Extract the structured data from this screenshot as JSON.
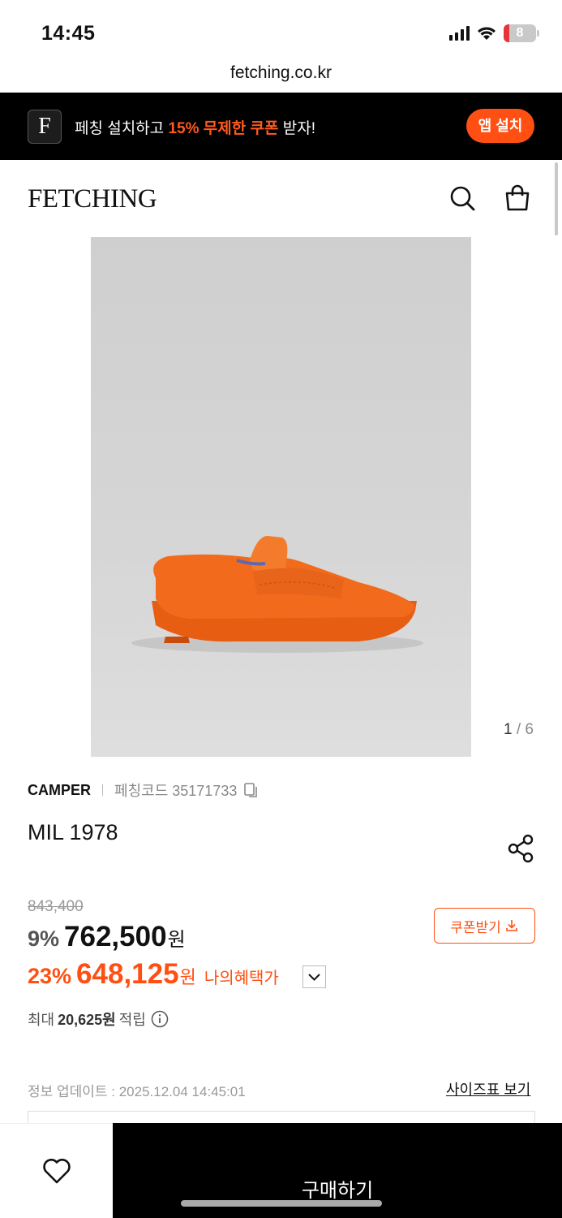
{
  "status": {
    "time": "14:45",
    "battery": "8"
  },
  "browser": {
    "url": "fetching.co.kr"
  },
  "banner": {
    "logo_letter": "F",
    "text_pre": "페칭 설치하고 ",
    "text_highlight": "15% 무제한 쿠폰",
    "text_post": " 받자!",
    "install_label": "앱 설치"
  },
  "header": {
    "logo": "FETCHING"
  },
  "gallery": {
    "current": "1",
    "divider": " / ",
    "total": "6"
  },
  "product": {
    "brand": "CAMPER",
    "code_label": "페칭코드 35171733",
    "name": "MIL 1978"
  },
  "pricing": {
    "original": "843,400",
    "discount1": "9%",
    "price1": "762,500",
    "won": "원",
    "coupon_label": "쿠폰받기",
    "discount2": "23%",
    "price2": "648,125",
    "benefit_label": "나의혜택가",
    "points_pre": "최대",
    "points_value": "20,625원",
    "points_post": "적립"
  },
  "meta": {
    "update_info": "정보 업데이트 : 2025.12.04 14:45:01",
    "size_chart": "사이즈표 보기"
  },
  "bottom": {
    "buy_label": "구매하기"
  },
  "colors": {
    "accent": "#ff4f12",
    "shoe": "#f26a1b",
    "dark": "#000000"
  }
}
